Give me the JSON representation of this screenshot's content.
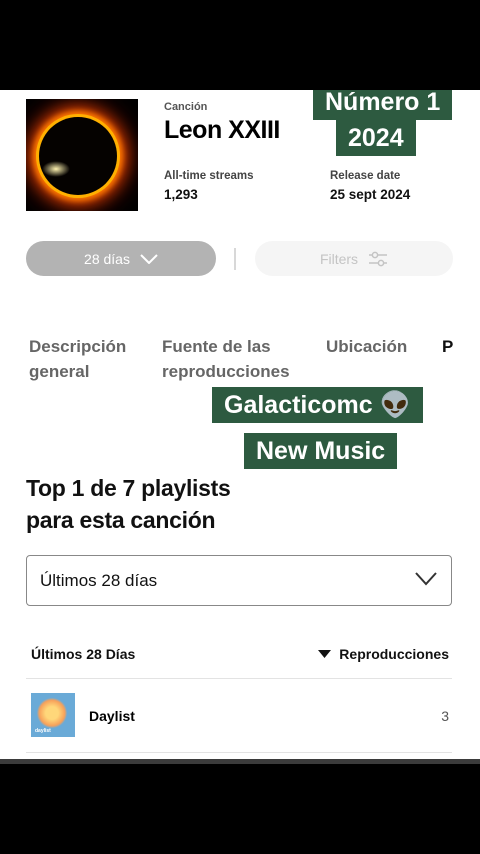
{
  "song": {
    "type_label": "Canción",
    "title": "Leon XXIII",
    "streams_label": "All-time streams",
    "streams_value": "1,293",
    "release_label": "Release date",
    "release_value": "25 sept 2024"
  },
  "overlays": {
    "tag1_line1": "Número 1",
    "tag1_line2": "2024",
    "tag2_line1": "Galacticomc 👽",
    "tag2_line2": "New Music"
  },
  "filters": {
    "range_label": "28 días",
    "filters_label": "Filters"
  },
  "tabs": [
    {
      "label_line1": "Descripción",
      "label_line2": "general"
    },
    {
      "label_line1": "Fuente de las",
      "label_line2": "reproducciones"
    },
    {
      "label_line1": "Ubicación",
      "label_line2": ""
    },
    {
      "label_line1": "P",
      "label_line2": ""
    }
  ],
  "playlists": {
    "title_line1": "Top 1 de 7 playlists",
    "title_line2": "para esta canción",
    "select_value": "Últimos 28 días",
    "col_period": "Últimos 28 Días",
    "col_sort": "Reproducciones",
    "rows": [
      {
        "thumb_text": "daylist",
        "name": "Daylist",
        "value": "3"
      }
    ]
  },
  "icons": {
    "range_chevron": "chevron-down-icon",
    "filters": "sliders-icon",
    "select_chevron": "chevron-down-icon",
    "sort": "sort-down-triangle-icon"
  },
  "colors": {
    "overlay_green": "#2d5a40",
    "pill_gray": "#b3b3b3"
  }
}
